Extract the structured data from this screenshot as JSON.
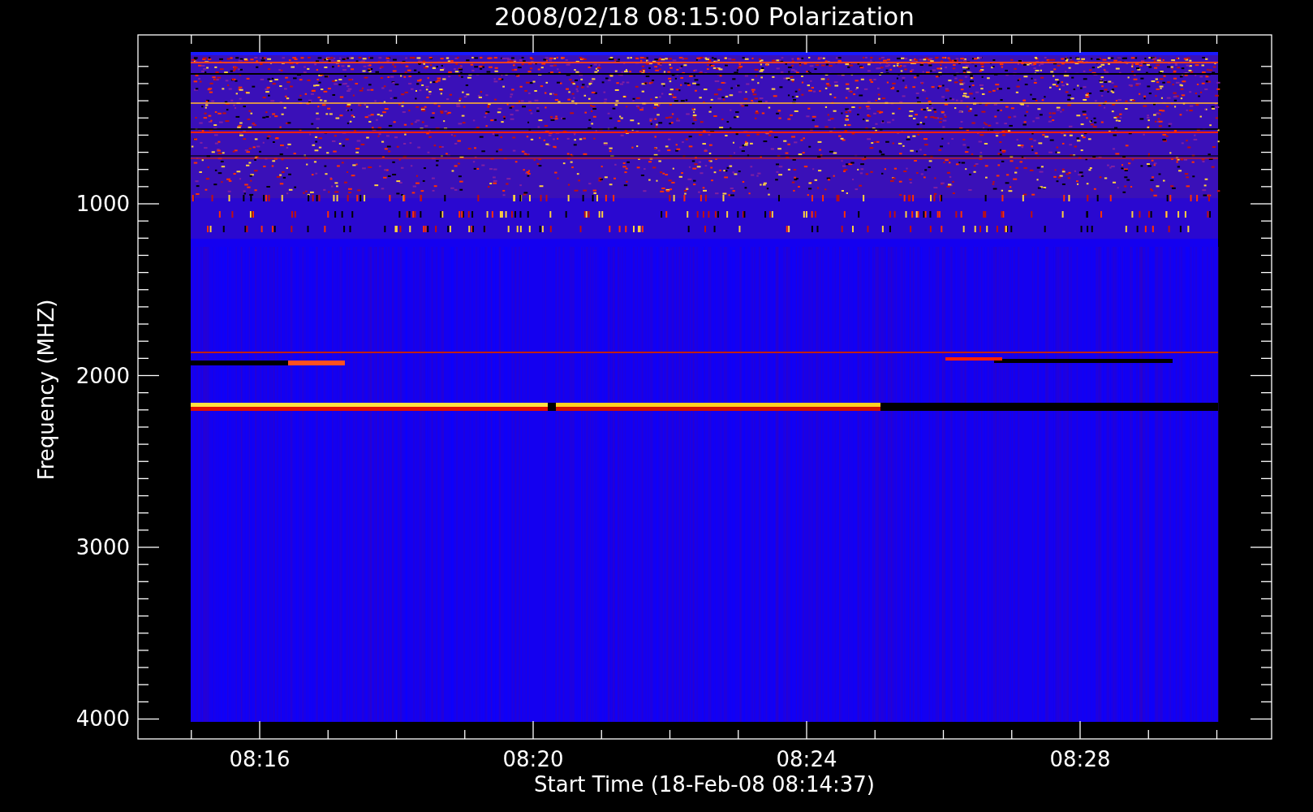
{
  "title": "2008/02/18 08:15:00 Polarization",
  "y_axis": {
    "label": "Frequency (MHZ)",
    "tick_labels": [
      "1000",
      "2000",
      "3000",
      "4000"
    ]
  },
  "x_axis": {
    "label": "Start Time (18-Feb-08 08:14:37)",
    "tick_labels": [
      "08:16",
      "08:20",
      "08:24",
      "08:28"
    ]
  }
}
